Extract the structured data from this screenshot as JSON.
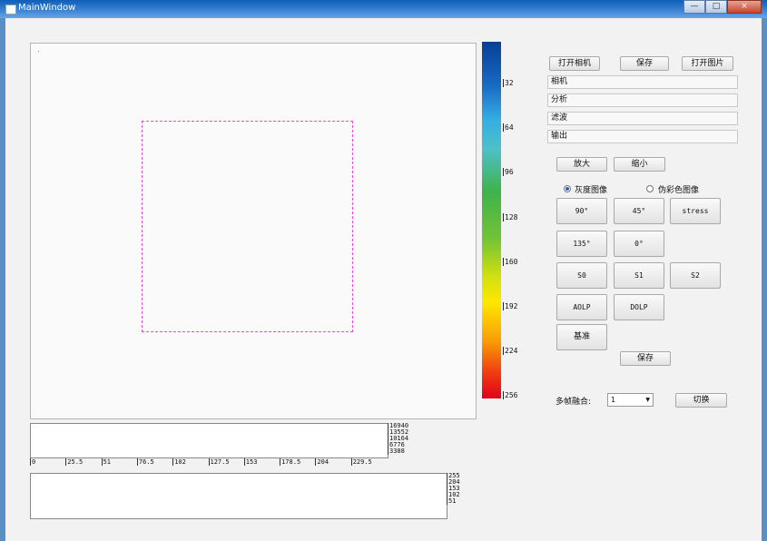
{
  "window": {
    "title": "MainWindow",
    "minimize": "—",
    "maximize": "□",
    "close": "×"
  },
  "toolbar": {
    "open_camera": "打开相机",
    "save": "保存",
    "open_image": "打开图片"
  },
  "panels": [
    {
      "label": "相机"
    },
    {
      "label": "分析"
    },
    {
      "label": "滤波"
    },
    {
      "label": "输出"
    }
  ],
  "zoom": {
    "zoom_in": "放大",
    "zoom_out": "缩小"
  },
  "modes": {
    "gray": "灰度图像",
    "pseudo": "伪彩色图像",
    "selected": "gray"
  },
  "angle_buttons": {
    "b90": "90°",
    "b45": "45°",
    "stress": "stress",
    "b135": "135°",
    "b0": "0°"
  },
  "stokes_buttons": {
    "s0": "S0",
    "s1": "S1",
    "s2": "S2",
    "aolp": "AOLP",
    "dolp": "DOLP",
    "baseline": "基准"
  },
  "save2": "保存",
  "fusion": {
    "label": "多帧融合:",
    "value": "1",
    "switch": "切换"
  },
  "colorbar": {
    "ticks": [
      "32",
      "64",
      "96",
      "128",
      "160",
      "192",
      "224",
      "256"
    ]
  },
  "histogram_top": {
    "y_ticks": [
      "16940",
      "13552",
      "10164",
      "6776",
      "3388"
    ],
    "x_ticks": [
      "0",
      "25.5",
      "51",
      "76.5",
      "102",
      "127.5",
      "153",
      "178.5",
      "204",
      "229.5"
    ]
  },
  "histogram_bottom": {
    "y_ticks": [
      "255",
      "204",
      "153",
      "102",
      "51"
    ]
  }
}
